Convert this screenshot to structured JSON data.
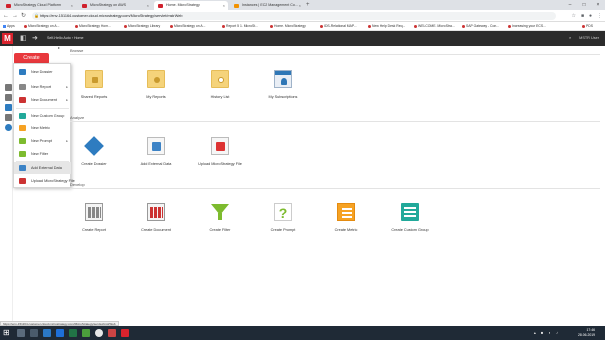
{
  "browser": {
    "tabs": [
      {
        "label": "MicroStrategy Cloud Platform",
        "active": false
      },
      {
        "label": "MicroStrategy on AWS",
        "active": false
      },
      {
        "label": "Home. MicroStrategy",
        "active": true
      },
      {
        "label": "Instances | EC2 Management Co...",
        "active": false
      }
    ],
    "url": "https://env-151164.customer.cloud.microstrategy.com/MicroStrategy/servlet/mstrWeb",
    "bookmarks": [
      "Apps",
      "MicroStrategy on A...",
      "MicroStrategy Hom...",
      "MicroStrategy Library",
      "MicroStrategy on A...",
      "Report 5 1. MicroSt...",
      "Home. MicroStrategy",
      "IDS-Relational MAP...",
      "New Help Desk Req...",
      "WELCOME. MicroStra...",
      "SAP Gateway - Con...",
      "Increasing your ECS...",
      "PDS"
    ]
  },
  "header": {
    "logo": "M",
    "breadcrumb": "Self-Hello Auto  ›  Home",
    "user_label": "MSTR User"
  },
  "create": {
    "button_label": "Create",
    "menu": [
      {
        "label": "New Dossier",
        "icon": "dossier-icon",
        "color": "#2e7cc0",
        "submenu": false
      },
      {
        "label": "New Report",
        "icon": "report-icon",
        "color": "#888888",
        "submenu": true
      },
      {
        "label": "New Document",
        "icon": "document-icon",
        "color": "#cc3333",
        "submenu": true
      },
      {
        "label": "New Custom Group",
        "icon": "custom-group-icon",
        "color": "#21a99a",
        "submenu": false
      },
      {
        "label": "New Metric",
        "icon": "metric-icon",
        "color": "#f6a223",
        "submenu": false
      },
      {
        "label": "New Prompt",
        "icon": "prompt-icon",
        "color": "#7dbb2e",
        "submenu": true
      },
      {
        "label": "New Filter",
        "icon": "filter-icon",
        "color": "#7dbb2e",
        "submenu": false
      },
      {
        "label": "Add External Data",
        "icon": "external-data-icon",
        "color": "#3c83c6",
        "submenu": false
      },
      {
        "label": "Upload MicroStrategy File",
        "icon": "upload-file-icon",
        "color": "#cc3333",
        "submenu": false
      }
    ]
  },
  "sections": {
    "browse": {
      "title": "Browse",
      "tiles": [
        "Shared Reports",
        "My Reports",
        "History List",
        "My Subscriptions"
      ]
    },
    "analyze": {
      "title": "Analyze",
      "tiles": [
        "Create Dossier",
        "Add External Data",
        "Upload MicroStrategy File"
      ]
    },
    "develop": {
      "title": "Develop",
      "tiles": [
        "Create Report",
        "Create Document",
        "Create Filter",
        "Create Prompt",
        "Create Metric",
        "Create Custom Group"
      ]
    }
  },
  "status_url": "https://env-151164.customer.cloud.microstrategy.com/MicroStrategy/servlet/mstrWeb",
  "taskbar": {
    "time": "17:46",
    "date": "28.06.2019"
  }
}
